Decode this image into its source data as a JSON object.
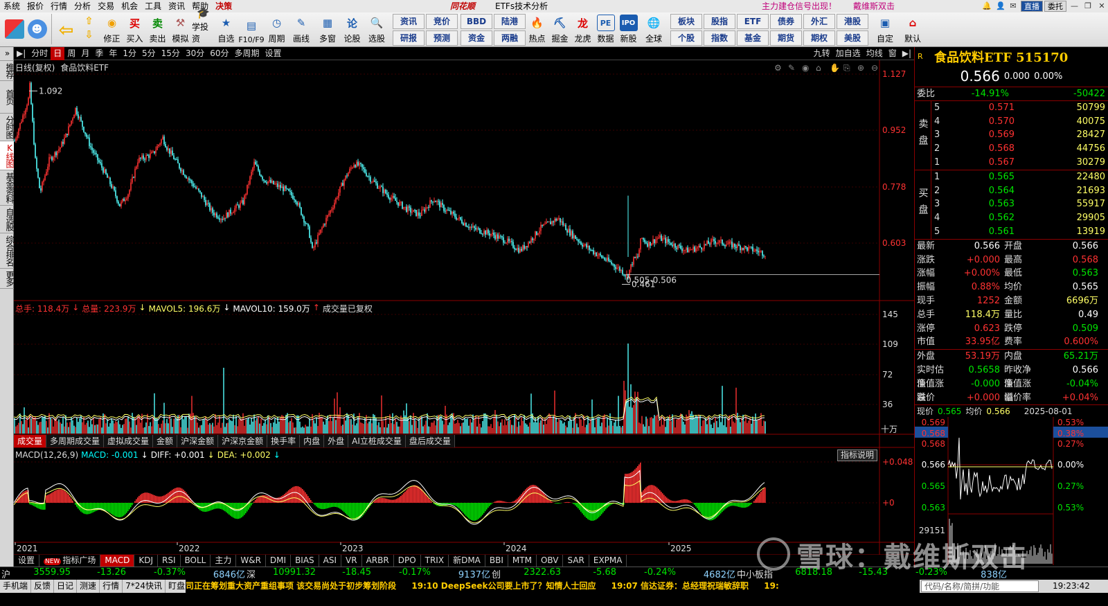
{
  "menu": {
    "items": [
      "系统",
      "报价",
      "行情",
      "分析",
      "交易",
      "机会",
      "工具",
      "资讯",
      "帮助"
    ],
    "hot_item": "决策",
    "brand": "同花顺",
    "title": "ETFs技术分析",
    "signal": "主力建仓信号出现！",
    "author": "戴维斯双击",
    "buttons": [
      "直播",
      "委托"
    ]
  },
  "toolbar": {
    "buttons": [
      "修正",
      "买入",
      "卖出",
      "模拟",
      "学投资",
      "自选",
      "F10/F9",
      "周期",
      "画线",
      "多窗",
      "论股",
      "选股"
    ],
    "grid1": [
      "资讯",
      "竞价",
      "研报",
      "预测"
    ],
    "grid2": [
      "BBD",
      "陆港",
      "资金",
      "两融"
    ],
    "buttons2": [
      "热点",
      "掘金",
      "龙虎",
      "数据",
      "新股",
      "全球"
    ],
    "grid3": [
      "板块",
      "股指",
      "ETF",
      "债券",
      "外汇",
      "港股",
      "个股",
      "指数",
      "基金",
      "期货",
      "期权",
      "美股"
    ],
    "buttons3": [
      "自定",
      "默认"
    ]
  },
  "left_tabs": [
    "推荐",
    "首页",
    "分时图",
    "K线图",
    "基金资料",
    "自选股",
    "综合排名",
    "更多"
  ],
  "period_tabs": [
    "分时",
    "日",
    "周",
    "月",
    "季",
    "年",
    "1分",
    "5分",
    "15分",
    "30分",
    "60分",
    "多周期",
    "设置"
  ],
  "period_active": "日",
  "period_right": [
    "九转",
    "加自选",
    "均线",
    "窗"
  ],
  "kline": {
    "label": "日线(复权)",
    "name": "食品饮料ETF",
    "high_label": "1.092",
    "low_label": "0.461",
    "range_label": "0.505-0.506",
    "price_ticks": [
      "1.127",
      "0.952",
      "0.778",
      "0.603"
    ]
  },
  "volume": {
    "total_hand": "总手: 118.4万",
    "total_vol": "总量: 223.9万",
    "mavol5": "MAVOL5: 196.6万",
    "mavol10": "MAVOL10: 159.0万",
    "note": "成交量已复权",
    "ticks": [
      "145",
      "109",
      "72",
      "36"
    ],
    "unit": "十万",
    "tabs": [
      "成交量",
      "多周期成交量",
      "虚拟成交量",
      "金额",
      "沪深金额",
      "沪深京金额",
      "换手率",
      "内盘",
      "外盘",
      "AI立桩成交量",
      "盘后成交量"
    ]
  },
  "macd": {
    "label": "MACD(12,26,9)",
    "macd": "MACD: -0.001",
    "diff": "DIFF: +0.001",
    "dea": "DEA: +0.002",
    "explain": "指标说明",
    "ticks": [
      "+0.048",
      "+0"
    ]
  },
  "years": [
    "2021",
    "2022",
    "2023",
    "2024",
    "2025"
  ],
  "indicator_tabs": [
    "设置",
    "指标广场",
    "MACD",
    "KDJ",
    "RSI",
    "BOLL",
    "主力",
    "W&R",
    "DMI",
    "BIAS",
    "ASI",
    "VR",
    "ARBR",
    "DPO",
    "TRIX",
    "新DMA",
    "BBI",
    "MTM",
    "OBV",
    "SAR",
    "EXPMA"
  ],
  "indicator_new": "NEW",
  "quote": {
    "r": "R",
    "name": "食品饮料ETF 515170",
    "price": "0.566",
    "change": "0.000",
    "pct": "0.00%",
    "weibi_label": "委比",
    "weibi": "-14.91%",
    "weicha": "-50422",
    "sell_label": "卖盘",
    "buy_label": "买盘",
    "sells": [
      {
        "lv": "5",
        "p": "0.571",
        "v": "50799"
      },
      {
        "lv": "4",
        "p": "0.570",
        "v": "40075"
      },
      {
        "lv": "3",
        "p": "0.569",
        "v": "28427"
      },
      {
        "lv": "2",
        "p": "0.568",
        "v": "44756"
      },
      {
        "lv": "1",
        "p": "0.567",
        "v": "30279"
      }
    ],
    "buys": [
      {
        "lv": "1",
        "p": "0.565",
        "v": "22480"
      },
      {
        "lv": "2",
        "p": "0.564",
        "v": "21693"
      },
      {
        "lv": "3",
        "p": "0.563",
        "v": "55917"
      },
      {
        "lv": "4",
        "p": "0.562",
        "v": "29905"
      },
      {
        "lv": "5",
        "p": "0.561",
        "v": "13919"
      }
    ],
    "stats": [
      [
        "最新",
        "0.566",
        "开盘",
        "0.566"
      ],
      [
        "涨跌",
        "+0.000",
        "最高",
        "0.568"
      ],
      [
        "涨幅",
        "+0.00%",
        "最低",
        "0.563"
      ],
      [
        "振幅",
        "0.88%",
        "均价",
        "0.565"
      ],
      [
        "现手",
        "1252",
        "金额",
        "6696万"
      ],
      [
        "总手",
        "118.4万",
        "量比",
        "0.49"
      ],
      [
        "涨停",
        "0.623",
        "跌停",
        "0.509"
      ],
      [
        "市值",
        "33.95亿",
        "费率",
        "0.600%"
      ]
    ],
    "stats2": [
      [
        "外盘",
        "53.19万",
        "内盘",
        "65.21万"
      ],
      [
        "实时估值",
        "0.5658",
        "昨收净值",
        "0.566"
      ],
      [
        "净值涨跌",
        "-0.000",
        "净值涨幅",
        "-0.04%"
      ],
      [
        "溢价",
        "+0.000",
        "溢价率",
        "+0.04%"
      ]
    ]
  },
  "mini": {
    "now_label": "现价",
    "now": "0.565",
    "avg_label": "均价",
    "avg": "0.566",
    "date": "2025-08-01",
    "left_ticks": [
      "0.569",
      "0.568",
      "0.568",
      "0.566",
      "0.565",
      "0.563"
    ],
    "right_ticks": [
      "0.53%",
      "0.38%",
      "0.27%",
      "0.00%",
      "0.27%",
      "0.53%"
    ],
    "vol_tick": "29151"
  },
  "indexbar": [
    {
      "name": "沪",
      "v": "3559.95",
      "c": "-13.26",
      "p": "-0.37%",
      "amt": "6846亿"
    },
    {
      "name": "深",
      "v": "10991.32",
      "c": "-18.45",
      "p": "-0.17%",
      "amt": "9137亿"
    },
    {
      "name": "创",
      "v": "2322.63",
      "c": "-5.68",
      "p": "-0.24%",
      "amt": "4682亿"
    },
    {
      "name": "中小板指",
      "v": "6818.18",
      "c": "-15.43",
      "p": "-0.23%",
      "amt": "838亿"
    }
  ],
  "status": {
    "items": [
      "手机端",
      "反馈",
      "日记",
      "测速",
      "行情",
      "7*24快讯",
      "盯盘"
    ],
    "ticker": [
      "司正在筹划重大资产重组事项 该交易尚处于初步筹划阶段",
      "19:10 DeepSeek公司要上市了？知情人士回应",
      "19:07 信达证券：总经理祝瑞敏辞职",
      "19:"
    ],
    "search": "代码/名称/简拼/功能",
    "clock": "19:23:42"
  },
  "watermark": "雪球：戴维斯双击"
}
